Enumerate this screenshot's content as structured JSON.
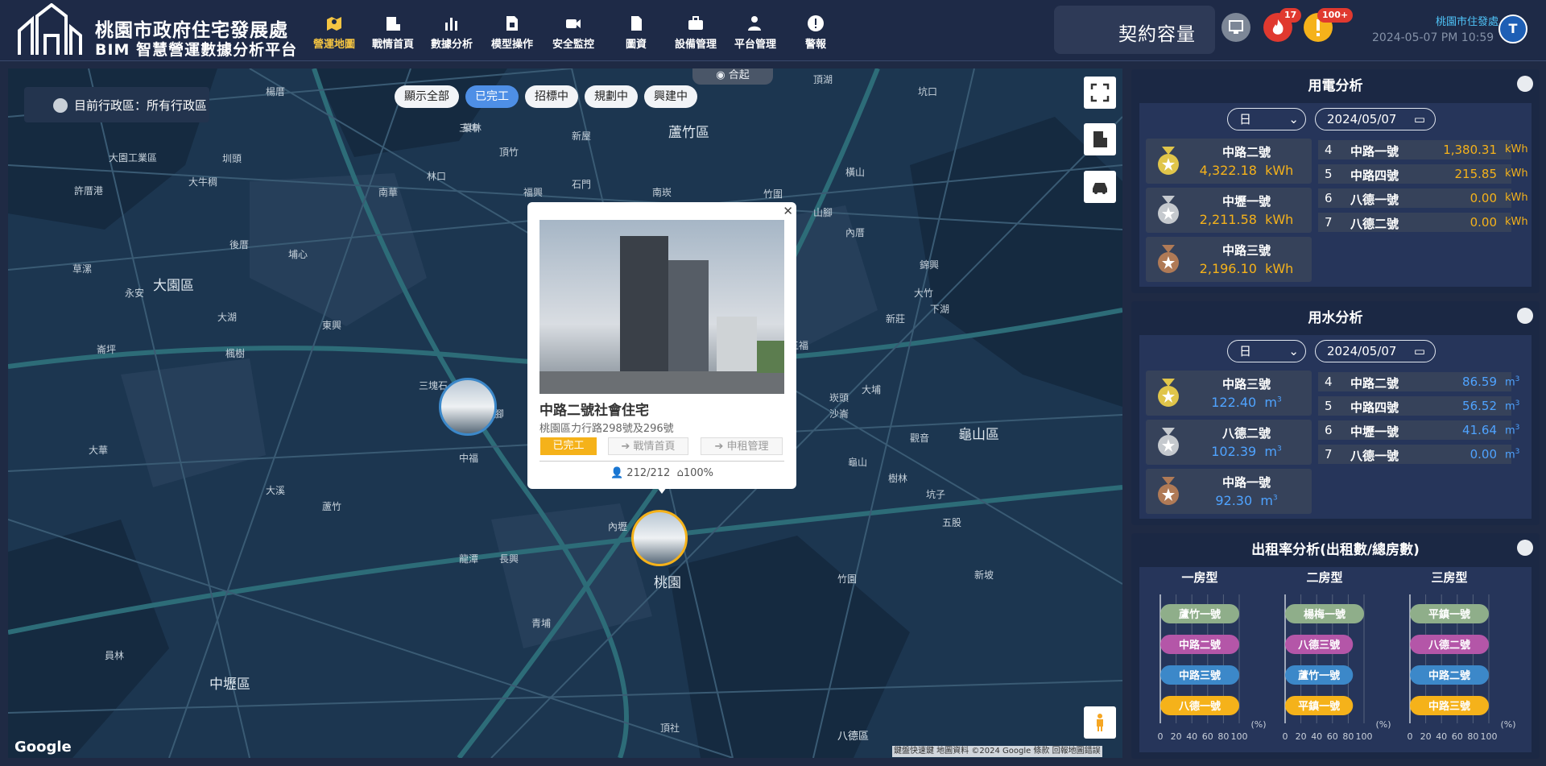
{
  "header": {
    "title_line1": "桃園市政府住宅發展處",
    "title_line2": "BIM 智慧營運數據分析平台",
    "nav": [
      {
        "label": "營運地圖",
        "icon": "map-pin-icon",
        "active": true
      },
      {
        "label": "戰情首頁",
        "icon": "building-chart-icon",
        "active": false
      },
      {
        "label": "數據分析",
        "icon": "bar-chart-icon",
        "active": false
      },
      {
        "label": "模型操作",
        "icon": "document-cube-icon",
        "active": false
      },
      {
        "label": "安全監控",
        "icon": "camera-icon",
        "active": false
      },
      {
        "label": "圖資",
        "icon": "document-icon",
        "active": false
      },
      {
        "label": "設備管理",
        "icon": "toolbox-icon",
        "active": false
      },
      {
        "label": "平台管理",
        "icon": "user-gear-icon",
        "active": false
      },
      {
        "label": "警報",
        "icon": "alert-icon",
        "active": false
      }
    ],
    "capacity_label": "契約容量",
    "fire_badge": "17",
    "warning_badge": "100+",
    "org_name": "桃園市住發處",
    "datetime": "2024-05-07 PM 10:59",
    "avatar_letter": "T",
    "accent_color": "#f5c542"
  },
  "map": {
    "district_selector": "目前行政區：所有行政區",
    "filters": [
      {
        "label": "顯示全部",
        "active": false
      },
      {
        "label": "已完工",
        "active": true
      },
      {
        "label": "招標中",
        "active": false
      },
      {
        "label": "規劃中",
        "active": false
      },
      {
        "label": "興建中",
        "active": false
      }
    ],
    "collapse_label": "合起",
    "popup": {
      "title": "中路二號社會住宅",
      "address": "桃園區力行路298號及296號",
      "status": "已完工",
      "buttons": [
        "戰情首頁",
        "申租管理"
      ],
      "occupancy": "212/212",
      "rate": "100%"
    },
    "place_labels": {
      "luzhu": "蘆竹區",
      "dayuan": "大園區",
      "guishan": "龜山區",
      "zhongli": "中壢區",
      "taoyuan": "桃園",
      "bade": "八德區",
      "small": [
        "楊厝",
        "坑口",
        "大園工業區",
        "圳頭",
        "許厝港",
        "大牛稠",
        "橫山",
        "內厝",
        "竹圍",
        "菓林",
        "埔心",
        "南崁",
        "錦興",
        "大竹",
        "山腳",
        "新莊",
        "大湖",
        "下湖",
        "大埔",
        "頂湖",
        "永安",
        "草漯",
        "沙崙",
        "觀音",
        "樹林",
        "坑子",
        "長興",
        "五福",
        "南興",
        "蘆竹",
        "五股",
        "新坡",
        "崁頭",
        "楓樹",
        "崙坪",
        "竹園",
        "內壢",
        "中路",
        "龍潭",
        "福興",
        "石門",
        "大華",
        "龜山",
        "林口",
        "頂社",
        "大溪",
        "青埔",
        "南華",
        "三塊石",
        "後厝",
        "大坡腳",
        "東興",
        "中福",
        "三埤",
        "員林",
        "新屋",
        "頂竹",
        "拔子林"
      ]
    },
    "google": "Google",
    "attribution": "鍵盤快速鍵  地圖資料 ©2024 Google  條款  回報地圖錯誤"
  },
  "electricity": {
    "title": "用電分析",
    "period": "日",
    "date": "2024/05/07",
    "top3": [
      {
        "name": "中路二號",
        "value": "4,322.18",
        "unit": "kWh"
      },
      {
        "name": "中壢一號",
        "value": "2,211.58",
        "unit": "kWh"
      },
      {
        "name": "中路三號",
        "value": "2,196.10",
        "unit": "kWh"
      }
    ],
    "rest": [
      {
        "rank": "4",
        "name": "中路一號",
        "value": "1,380.31",
        "unit": "kWh"
      },
      {
        "rank": "5",
        "name": "中路四號",
        "value": "215.85",
        "unit": "kWh"
      },
      {
        "rank": "6",
        "name": "八德一號",
        "value": "0.00",
        "unit": "kWh"
      },
      {
        "rank": "7",
        "name": "八德二號",
        "value": "0.00",
        "unit": "kWh"
      }
    ]
  },
  "water": {
    "title": "用水分析",
    "period": "日",
    "date": "2024/05/07",
    "top3": [
      {
        "name": "中路三號",
        "value": "122.40",
        "unit": "m3"
      },
      {
        "name": "八德二號",
        "value": "102.39",
        "unit": "m3"
      },
      {
        "name": "中路一號",
        "value": "92.30",
        "unit": "m3"
      }
    ],
    "rest": [
      {
        "rank": "4",
        "name": "中路二號",
        "value": "86.59",
        "unit": "m3"
      },
      {
        "rank": "5",
        "name": "中路四號",
        "value": "56.52",
        "unit": "m3"
      },
      {
        "rank": "6",
        "name": "中壢一號",
        "value": "41.64",
        "unit": "m3"
      },
      {
        "rank": "7",
        "name": "八德一號",
        "value": "0.00",
        "unit": "m3"
      }
    ]
  },
  "rental": {
    "title": "出租率分析(出租數/總房數)",
    "unit": "(%)",
    "ticks": [
      "0",
      "20",
      "40",
      "60",
      "80",
      "100"
    ],
    "charts": [
      {
        "title": "一房型",
        "bars": [
          {
            "name": "蘆竹一號",
            "value": 100,
            "color": "#8fae8a"
          },
          {
            "name": "中路二號",
            "value": 100,
            "color": "#b456a8"
          },
          {
            "name": "中路三號",
            "value": 100,
            "color": "#3c88c9"
          },
          {
            "name": "八德一號",
            "value": 100,
            "color": "#f5b21a"
          }
        ]
      },
      {
        "title": "二房型",
        "bars": [
          {
            "name": "楊梅一號",
            "value": 100,
            "color": "#8fae8a"
          },
          {
            "name": "八德三號",
            "value": 86,
            "color": "#b456a8"
          },
          {
            "name": "蘆竹一號",
            "value": 86,
            "color": "#3c88c9"
          },
          {
            "name": "平鎮一號",
            "value": 86,
            "color": "#f5b21a"
          }
        ]
      },
      {
        "title": "三房型",
        "bars": [
          {
            "name": "平鎮一號",
            "value": 100,
            "color": "#8fae8a"
          },
          {
            "name": "八德二號",
            "value": 100,
            "color": "#b456a8"
          },
          {
            "name": "中路二號",
            "value": 100,
            "color": "#3c88c9"
          },
          {
            "name": "中路三號",
            "value": 100,
            "color": "#f5b21a"
          }
        ]
      }
    ]
  }
}
